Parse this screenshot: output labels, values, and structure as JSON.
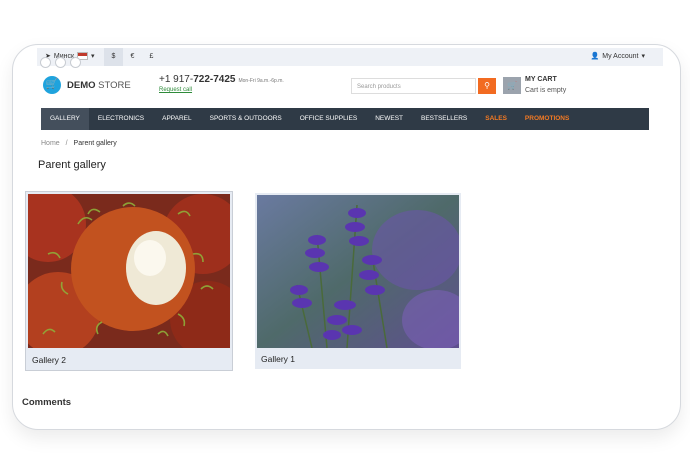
{
  "topbar": {
    "location": "Минск",
    "currencies": [
      "$",
      "€",
      "£"
    ],
    "active_currency": "$",
    "account": "My Account"
  },
  "header": {
    "logo_bold": "DEMO",
    "logo_light": "STORE",
    "phone_prefix": "+1 917-",
    "phone_number": "722-7425",
    "hours": "Mon-Fri 9a.m.-6p.m.",
    "request_call": "Request call",
    "search_placeholder": "Search products",
    "cart_title": "MY CART",
    "cart_status": "Cart is empty"
  },
  "nav": {
    "items": [
      {
        "label": "GALLERY",
        "active": true
      },
      {
        "label": "ELECTRONICS"
      },
      {
        "label": "APPAREL"
      },
      {
        "label": "SPORTS & OUTDOORS"
      },
      {
        "label": "OFFICE SUPPLIES"
      },
      {
        "label": "NEWEST"
      },
      {
        "label": "BESTSELLERS"
      },
      {
        "label": "SALES",
        "accent": true
      },
      {
        "label": "PROMOTIONS",
        "accent": true
      }
    ]
  },
  "breadcrumb": {
    "home": "Home",
    "separator": "/",
    "current": "Parent gallery"
  },
  "page": {
    "title": "Parent gallery",
    "comments_heading": "Comments"
  },
  "galleries": [
    {
      "label": "Gallery 2",
      "image": "rambutan-photo"
    },
    {
      "label": "Gallery 1",
      "image": "lavender-photo"
    }
  ],
  "colors": {
    "accent": "#f26b21",
    "nav_bg": "#2f3a46",
    "logo": "#1fa3dd",
    "card_bg": "#e6ebf3"
  }
}
